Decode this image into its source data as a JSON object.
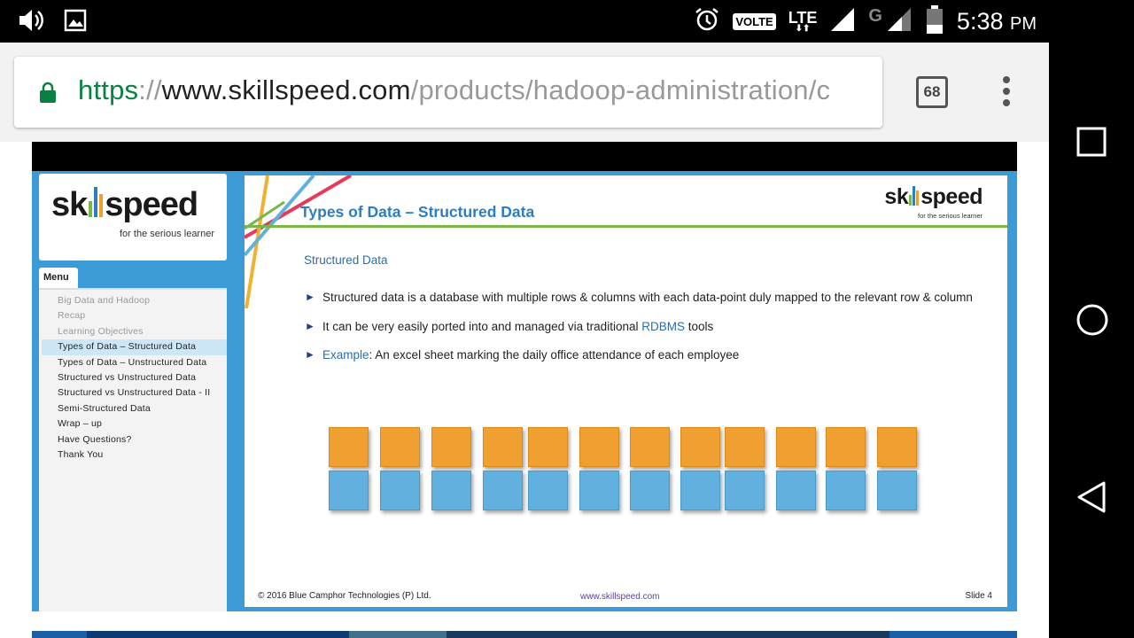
{
  "status_bar": {
    "volte": "VOLTE",
    "lte": "LTE",
    "g_label": "G",
    "time": "5:38",
    "ampm": "PM"
  },
  "browser": {
    "url_scheme": "https",
    "url_sep": "://",
    "url_host": "www.skillspeed.com",
    "url_path": "/products/hadoop-administration/c",
    "tab_count": "68"
  },
  "sidebar": {
    "logo_prefix": "sk",
    "logo_suffix": "speed",
    "logo_tagline": "for the serious learner",
    "menu_label": "Menu",
    "items": [
      {
        "label": "Big Data and Hadoop",
        "state": "muted"
      },
      {
        "label": "Recap",
        "state": "muted"
      },
      {
        "label": "Learning Objectives",
        "state": "muted"
      },
      {
        "label": "Types of Data – Structured Data",
        "state": "active"
      },
      {
        "label": "Types of Data – Unstructured Data",
        "state": "normal"
      },
      {
        "label": "Structured vs Unstructured Data",
        "state": "normal"
      },
      {
        "label": "Structured vs Unstructured Data - II",
        "state": "normal"
      },
      {
        "label": "Semi-Structured Data",
        "state": "normal"
      },
      {
        "label": "Wrap – up",
        "state": "normal"
      },
      {
        "label": "Have Questions?",
        "state": "normal"
      },
      {
        "label": "Thank You",
        "state": "normal"
      }
    ]
  },
  "slide": {
    "title": "Types of Data – Structured Data",
    "logo_prefix": "sk",
    "logo_suffix": "speed",
    "logo_tagline": "for the serious learner",
    "subheading": "Structured Data",
    "bullet1": "Structured data is a database with multiple rows & columns with each data-point duly mapped to the relevant row & column",
    "bullet2_pre": "It can be very easily ported into and managed via traditional ",
    "bullet2_hl": "RDBMS",
    "bullet2_post": " tools",
    "bullet3_hl": "Example",
    "bullet3_post": ": An excel sheet marking the daily office attendance of each employee",
    "footer_left": "© 2016 Blue Camphor Technologies (P) Ltd.",
    "footer_center": "www.skillspeed.com",
    "footer_right": "Slide 4",
    "grid_rows": [
      "orange",
      "blue"
    ],
    "grid_columns": 12
  },
  "colors": {
    "accent_blue": "#2c7ec0",
    "rule_green": "#7ab648",
    "cell_orange": "#f0a030",
    "cell_blue": "#62b0de",
    "player_frame": "#3c9ad6"
  }
}
